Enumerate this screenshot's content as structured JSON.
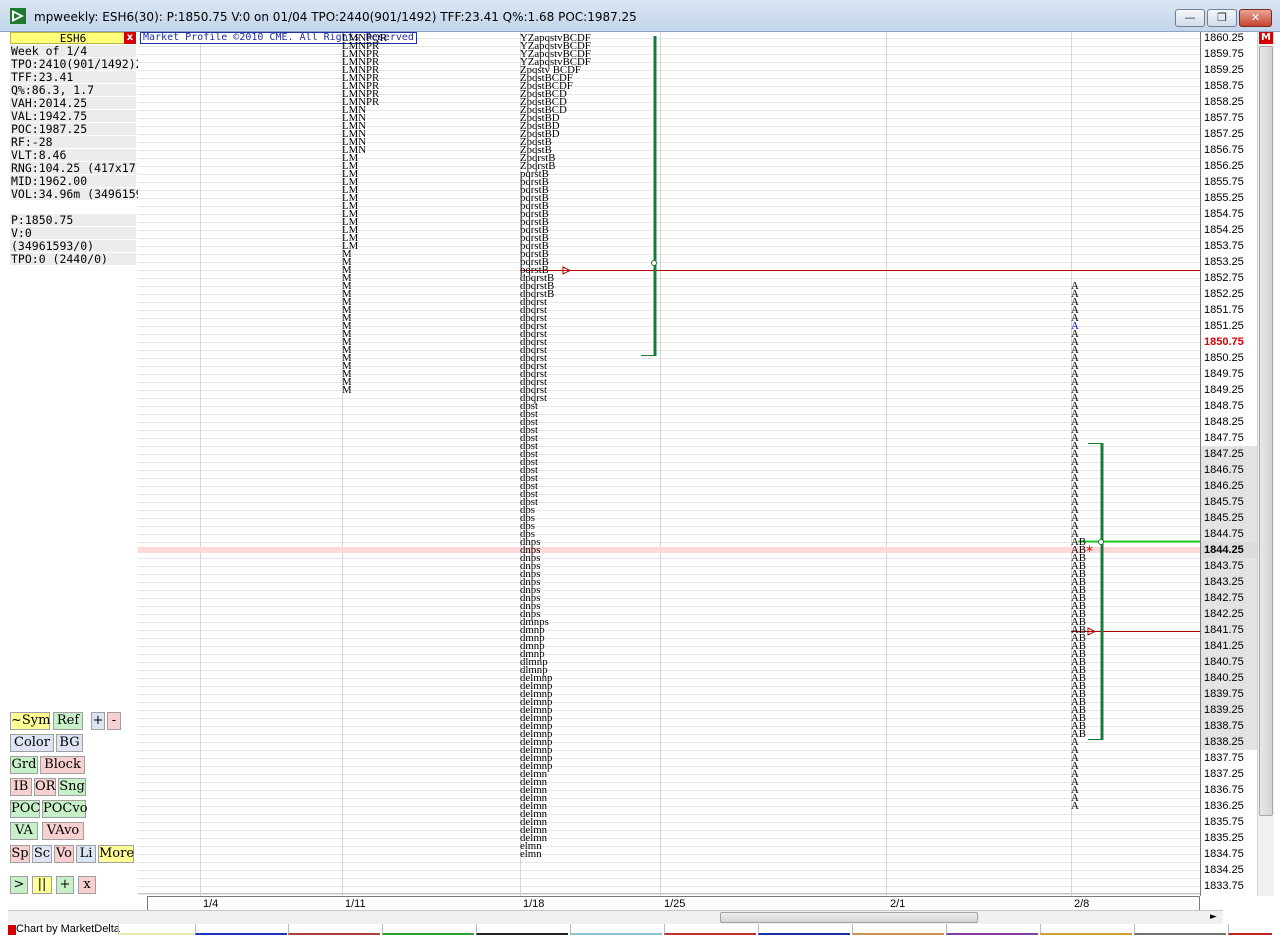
{
  "window": {
    "title": "mpweekly: ESH6(30): P:1850.75 V:0 on 01/04 TPO:2440(901/1492) TFF:23.41 Q%:1.68 POC:1987.25",
    "min_label": "—",
    "max_label": "❐",
    "close_label": "✕"
  },
  "info": {
    "symbol": "ESH6",
    "close_x": "x",
    "rows": [
      " Week of 1/4",
      "TPO:2410(901/1492)2440",
      "TFF:23.41",
      " Q%:86.3, 1.7",
      "VAH:2014.25",
      "VAL:1942.75",
      "POC:1987.25",
      " RF:-28",
      "VLT:8.46",
      "RNG:104.25 (417x17)",
      "MID:1962.00",
      "VOL:34.96m (34961593)",
      "",
      "  P:1850.75",
      "  V:0",
      "    (34961593/0)",
      "TPO:0 (2440/0)"
    ]
  },
  "buttons": {
    "sym": "~Sym",
    "ref": "Ref",
    "plus": "+",
    "minus": "-",
    "color": "Color",
    "bg": "BG",
    "grd": "Grd",
    "block": "Block",
    "ib": "IB",
    "or": "OR",
    "sng": "Sng",
    "poc": "POC",
    "pocvo": "POCvo",
    "va": "VA",
    "vavo": "VAvo",
    "sp": "Sp",
    "sc": "Sc",
    "vo": "Vo",
    "li": "Li",
    "more": "More",
    "play": ">",
    "pause": "||",
    "add": "+",
    "remove": "x"
  },
  "chart": {
    "copyright": "Market Profile ©2010 CME. All Rights Reserved",
    "colors": {
      "value_area": "#1a7a3a",
      "reference_line": "#b00000",
      "current_price_line": "#22cc22",
      "current_band": "#ffd8d8",
      "last_price": "#e00000",
      "open_marker": "#0000c0"
    },
    "price_labels": [
      "1860.25",
      "1859.75",
      "1859.25",
      "1858.75",
      "1858.25",
      "1857.75",
      "1857.25",
      "1856.75",
      "1856.25",
      "1855.75",
      "1855.25",
      "1854.75",
      "1854.25",
      "1853.75",
      "1853.25",
      "1852.75",
      "1852.25",
      "1851.75",
      "1851.25",
      "1850.75",
      "1850.25",
      "1849.75",
      "1849.25",
      "1848.75",
      "1848.25",
      "1847.75",
      "1847.25",
      "1846.75",
      "1846.25",
      "1845.75",
      "1845.25",
      "1844.75",
      "1844.25",
      "1843.75",
      "1843.25",
      "1842.75",
      "1842.25",
      "1841.75",
      "1841.25",
      "1840.75",
      "1840.25",
      "1839.75",
      "1839.25",
      "1838.75",
      "1838.25",
      "1837.75",
      "1837.25",
      "1836.75",
      "1836.25",
      "1835.75",
      "1835.25",
      "1834.75",
      "1834.25",
      "1833.75"
    ],
    "last_price": "1850.75",
    "current_price": "1844.25",
    "date_labels": [
      "1/4",
      "1/11",
      "1/18",
      "1/25",
      "2/1",
      "2/8"
    ],
    "profiles": {
      "week_1_11": [
        "LMNPQR",
        "LMNPR",
        "LMNPR",
        "LMNPR",
        "LMNPR",
        "LMNPR",
        "LMNPR",
        "LMNPR",
        "LMNPR",
        "LMN",
        "LMN",
        "LMN",
        "LMN",
        "LMN",
        "LMN",
        "LM",
        "LM",
        "LM",
        "LM",
        "LM",
        "LM",
        "LM",
        "LM",
        "LM",
        "LM",
        "LM",
        "LM",
        "M",
        "M",
        "M",
        "M",
        "M",
        "M",
        "M",
        "M",
        "M",
        "M",
        "M",
        "M",
        "M",
        "M",
        "M",
        "M",
        "M",
        "M"
      ],
      "week_1_18": [
        "YZapqstvBCDF",
        "YZapqstvBCDF",
        "YZapqstvBCDF",
        "YZapqstvBCDF",
        "Zpqstv BCDF",
        "ZpqstBCDF",
        "ZpqstBCDF",
        "ZpqstBCD",
        "ZpqstBCD",
        "ZpqstBCD",
        "ZpqstBD",
        "ZpqstBD",
        "ZpqstBD",
        "ZpqstB",
        "ZpqstB",
        "ZpqrstB",
        "ZpqrstB",
        "pqrstB",
        "pqrstB",
        "pqrstB",
        "pqrstB",
        "pqrstB",
        "pqrstB",
        "pqrstB",
        "pqrstB",
        "pqrstB",
        "pqrstB",
        "pqrstB",
        "pqrstB",
        "pqrstB",
        "dpqrstB",
        "dpqrstB",
        "dpqrstB",
        "dpqrst",
        "dpqrst",
        "dpqrst",
        "dpqrst",
        "dpqrst",
        "dpqrst",
        "dpqrst",
        "dpqrst",
        "dpqrst",
        "dpqrst",
        "dpqrst",
        "dpqrst",
        "dpqrst",
        "dpst",
        "dpst",
        "dpst",
        "dpst",
        "dpst",
        "dpst",
        "dpst",
        "dpst",
        "dpst",
        "dpst",
        "dpst",
        "dpst",
        "dpst",
        "dps",
        "dps",
        "dps",
        "dps",
        "dnps",
        "dnps",
        "dnps",
        "dnps",
        "dnps",
        "dnps",
        "dnps",
        "dnps",
        "dnps",
        "dnps",
        "dmnps",
        "dmnp",
        "dmnp",
        "dmnp",
        "dmnp",
        "dlmnp",
        "dlmnp",
        "delmnp",
        "delmnp",
        "delmnp",
        "delmnp",
        "delmnp",
        "delmnp",
        "delmnp",
        "delmnp",
        "delmnp",
        "delmnp",
        "delmnp",
        "delmnp",
        "delmn",
        "delmn",
        "delmn",
        "delmn",
        "delmn",
        "delmn",
        "delmn",
        "delmn",
        "delmn",
        "elmn",
        "elmn"
      ],
      "week_2_8": [
        "A",
        "A",
        "A",
        "A",
        "A",
        "A",
        "A",
        "A",
        "A",
        "A",
        "A",
        "A",
        "A",
        "A",
        "A",
        "A",
        "A",
        "A",
        "A",
        "A",
        "A",
        "A",
        "A",
        "A",
        "A",
        "A",
        "A",
        "A",
        "A",
        "A",
        "A",
        "A",
        "AB",
        "AB",
        "AB",
        "AB",
        "AB",
        "AB",
        "AB",
        "AB",
        "AB",
        "AB",
        "AB",
        "AB",
        "AB",
        "AB",
        "AB",
        "AB",
        "AB",
        "AB",
        "AB",
        "AB",
        "AB",
        "AB",
        "AB",
        "AB",
        "AB",
        "A",
        "A",
        "A",
        "A",
        "A",
        "A",
        "A",
        "A",
        "A"
      ]
    }
  },
  "status": {
    "credit": "Chart by MarketDelta"
  }
}
